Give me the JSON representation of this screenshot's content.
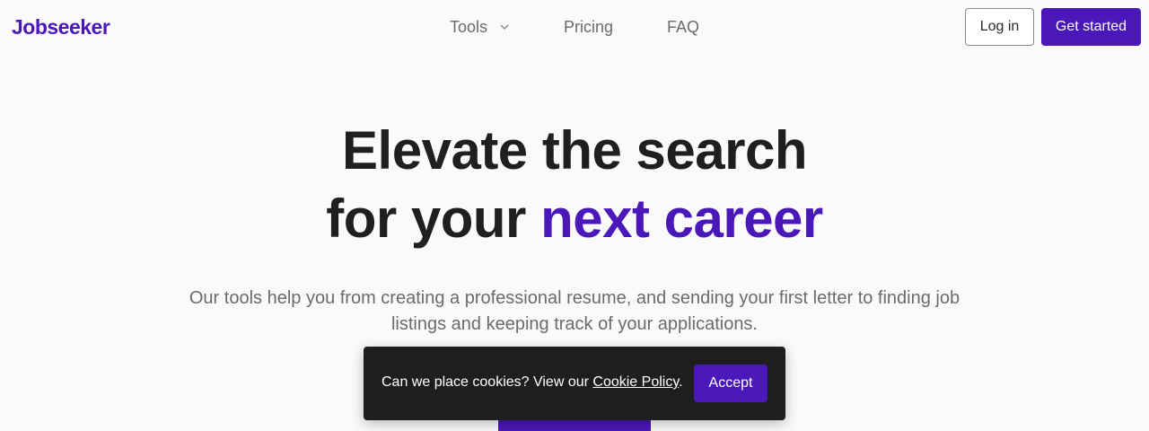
{
  "header": {
    "logo_text": "Jobseeker",
    "nav": [
      {
        "label": "Tools",
        "has_dropdown": true
      },
      {
        "label": "Pricing"
      },
      {
        "label": "FAQ"
      }
    ],
    "login_label": "Log in",
    "get_started_label": "Get started"
  },
  "hero": {
    "title_line1": "Elevate the search",
    "title_line2_prefix": "for your ",
    "title_line2_accent": "next career",
    "subtitle": "Our tools help you from creating a professional resume, and sending your first letter to finding job listings and keeping track of your applications."
  },
  "cookie_banner": {
    "text": "Can we place cookies? View our ",
    "link_label": "Cookie Policy",
    "suffix": ".",
    "accept_label": "Accept"
  },
  "colors": {
    "brand": "#4a17b8",
    "background": "#fafafa",
    "banner": "#1e1e1e"
  },
  "icons": {
    "dropdown": "chevron-down-icon"
  }
}
